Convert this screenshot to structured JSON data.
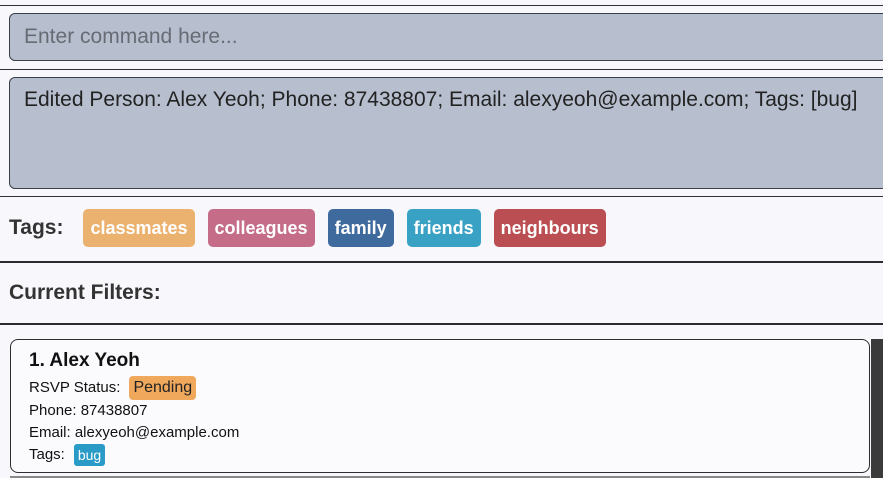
{
  "command": {
    "placeholder": "Enter command here...",
    "value": ""
  },
  "result": {
    "text": "Edited Person: Alex Yeoh; Phone: 87438807; Email: alexyeoh@example.com; Tags: [bug]"
  },
  "tags_bar": {
    "label": "Tags:",
    "tags": [
      {
        "label": "classmates",
        "color": "#ebb16e"
      },
      {
        "label": "colleagues",
        "color": "#c46c88"
      },
      {
        "label": "family",
        "color": "#3e6a9e"
      },
      {
        "label": "friends",
        "color": "#38a1c4"
      },
      {
        "label": "neighbours",
        "color": "#bb4e52"
      }
    ]
  },
  "filters": {
    "label": "Current Filters:"
  },
  "people": [
    {
      "index_name": "1. Alex Yeoh",
      "rsvp_label": "RSVP Status:",
      "rsvp_value": "Pending",
      "rsvp_color": "#f0a85c",
      "phone": "Phone: 87438807",
      "email": "Email: alexyeoh@example.com",
      "tags_label": "Tags:",
      "tags": [
        "bug"
      ],
      "tag_color": "#2a9bc7"
    }
  ]
}
